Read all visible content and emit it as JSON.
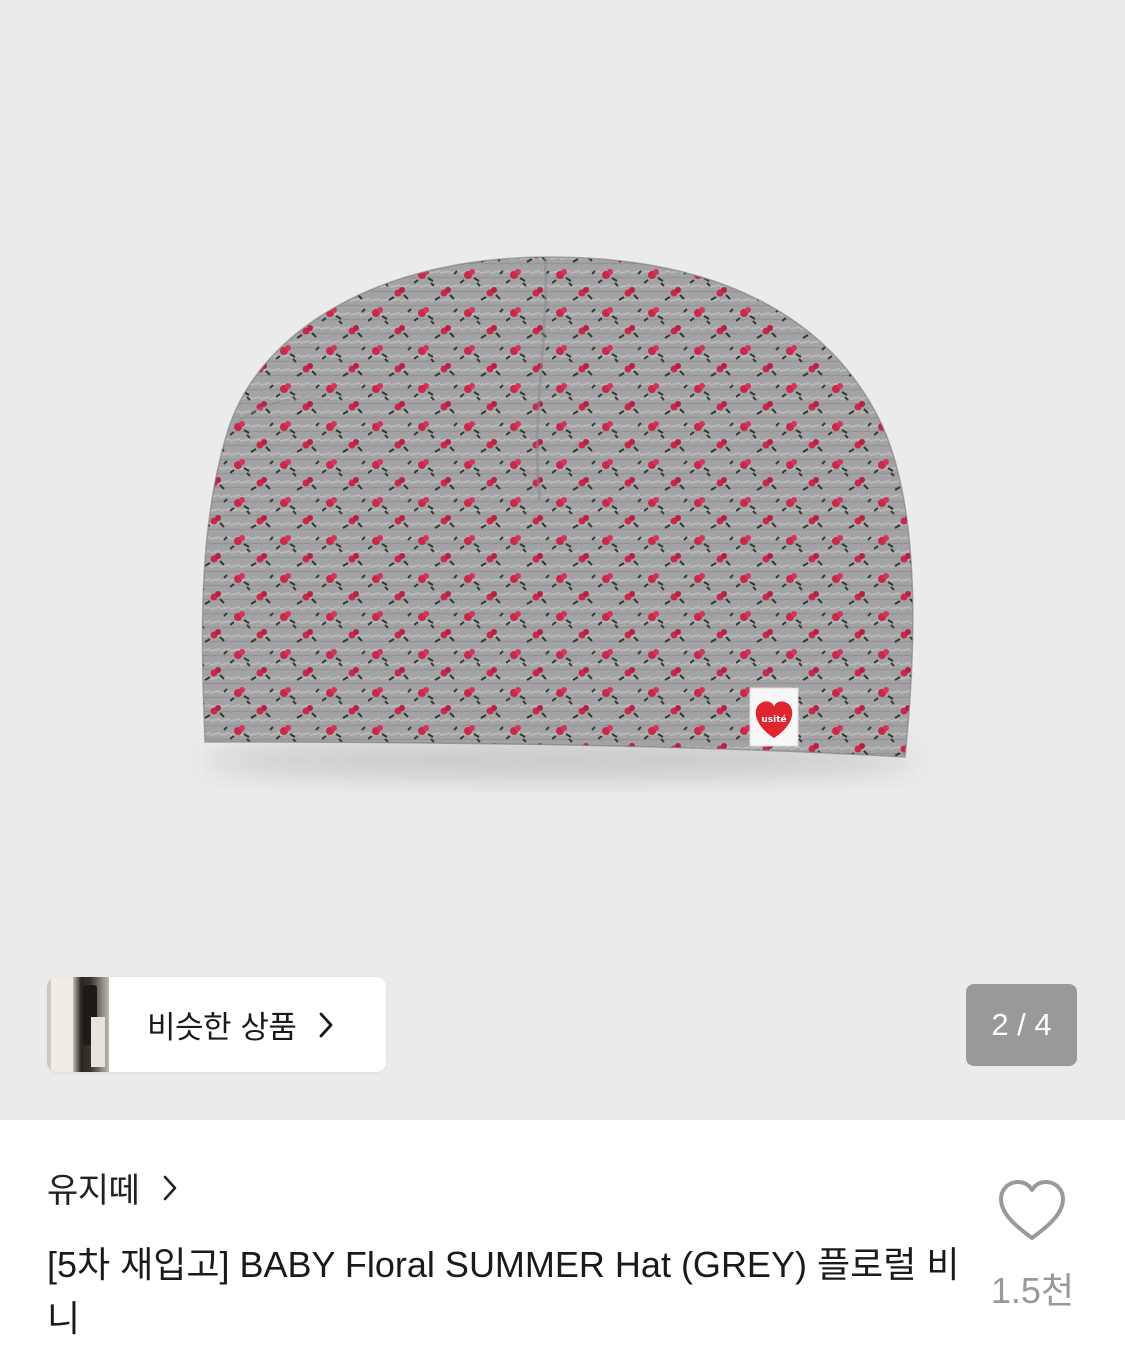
{
  "gallery": {
    "similar_products_label": "비슷한 상품",
    "page_counter": "2 / 4",
    "product_image_alt": "grey floral beanie hat with usité heart tag",
    "tag_text": "usité"
  },
  "product": {
    "brand": "유지떼",
    "title": "[5차 재입고] BABY Floral SUMMER Hat (GREY) 플로럴 비니",
    "like_count": "1.5천"
  },
  "colors": {
    "hero_bg": "#ebebeb",
    "hat_base": "#9f9fa1",
    "flower_red": "#c8284a",
    "leaf_dark": "#2f3a30",
    "tag_heart": "#e0252f",
    "counter_bg": "#999999"
  },
  "icons": {
    "like": "heart-outline-icon",
    "similar_chevron": "chevron-right-icon",
    "brand_chevron": "chevron-right-icon"
  }
}
